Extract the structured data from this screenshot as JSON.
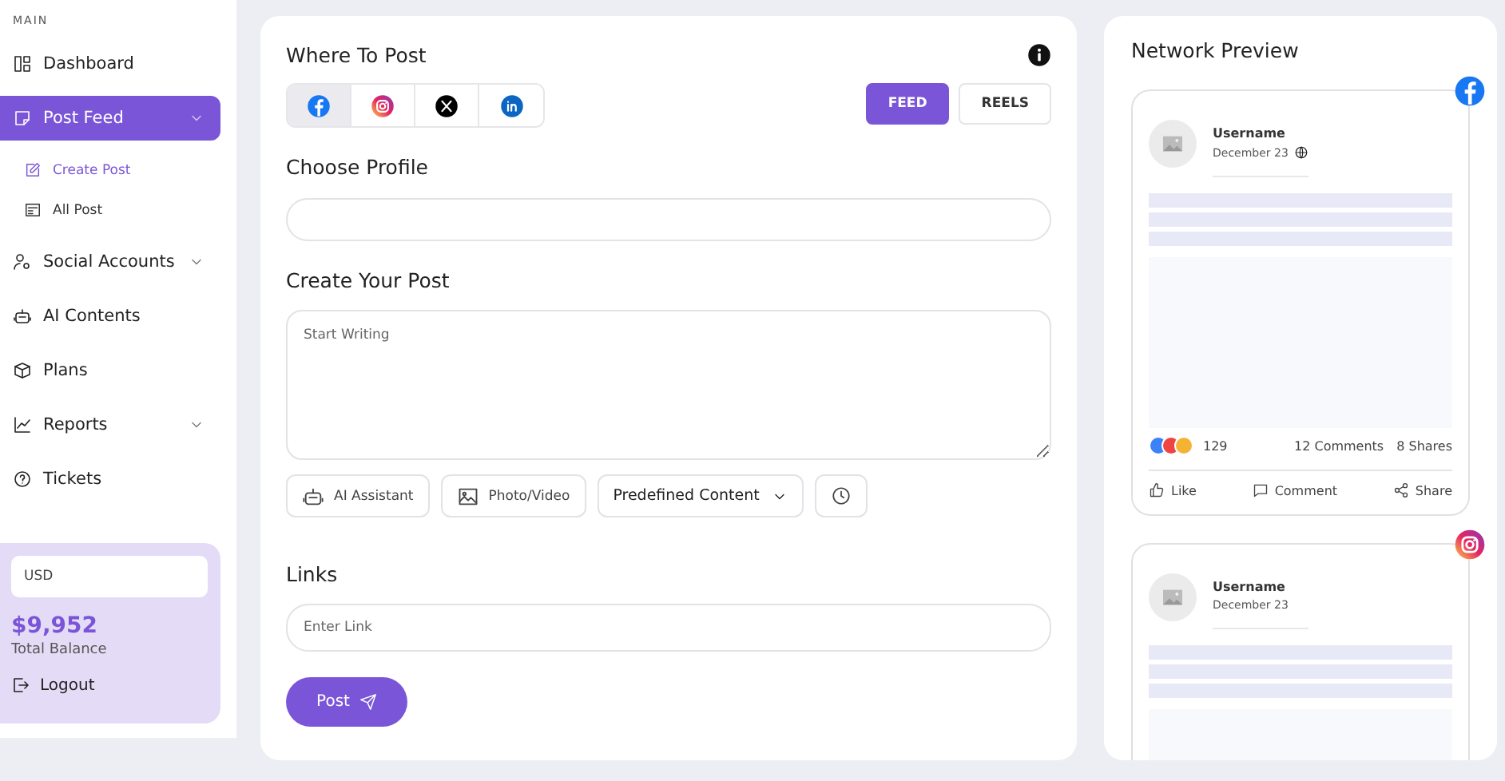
{
  "sidebar": {
    "section_label": "MAIN",
    "items": [
      {
        "label": "Dashboard",
        "kind": "link",
        "selected": false
      },
      {
        "label": "Post Feed",
        "kind": "group",
        "selected": true,
        "children": [
          {
            "label": "Create Post",
            "selected": true
          },
          {
            "label": "All Post",
            "selected": false
          }
        ]
      },
      {
        "label": "Social Accounts",
        "kind": "group",
        "selected": false
      },
      {
        "label": "AI Contents",
        "kind": "link",
        "selected": false
      },
      {
        "label": "Plans",
        "kind": "link",
        "selected": false
      },
      {
        "label": "Reports",
        "kind": "group",
        "selected": false
      },
      {
        "label": "Tickets",
        "kind": "link",
        "selected": false
      }
    ],
    "balance": {
      "currency": "USD",
      "amount": "$9,952",
      "label": "Total Balance"
    },
    "logout": "Logout"
  },
  "composer": {
    "where_to_post": {
      "title": "Where To Post",
      "networks": [
        {
          "kind": "facebook",
          "selected": true
        },
        {
          "kind": "instagram",
          "selected": false
        },
        {
          "kind": "x",
          "selected": false
        },
        {
          "kind": "linkedin",
          "selected": false
        }
      ],
      "post_types": [
        {
          "label": "FEED",
          "selected": true
        },
        {
          "label": "REELS",
          "selected": false
        }
      ]
    },
    "choose_profile": {
      "title": "Choose Profile"
    },
    "create_post": {
      "title": "Create Your Post",
      "placeholder": "Start Writing",
      "tools": [
        {
          "kind": "ai",
          "label": "AI Assistant"
        },
        {
          "kind": "media",
          "label": "Photo/Video"
        },
        {
          "kind": "dropdown",
          "label": "Predefined Content"
        },
        {
          "kind": "schedule"
        }
      ]
    },
    "links": {
      "title": "Links",
      "placeholder": "Enter Link"
    },
    "submit": "Post"
  },
  "preview": {
    "title": "Network Preview",
    "cards": [
      {
        "kind": "facebook",
        "username": "Username",
        "date": "December 23",
        "reactions": "129",
        "comments": "12 Comments",
        "shares": "8 Shares",
        "actions": [
          "Like",
          "Comment",
          "Share"
        ]
      },
      {
        "kind": "instagram",
        "username": "Username",
        "date": "December 23"
      }
    ]
  }
}
